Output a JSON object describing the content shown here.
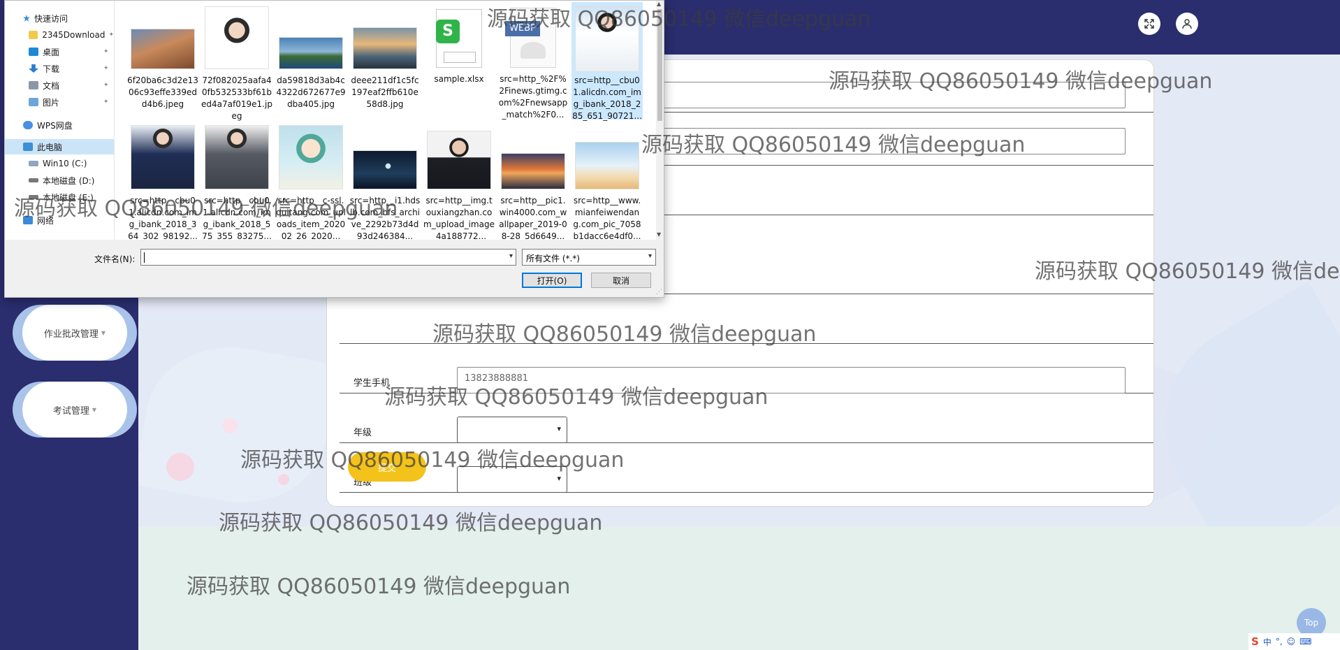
{
  "topbar": {
    "fullscreen_icon": "expand-icon",
    "user_icon": "user-icon"
  },
  "sidebar": {
    "items": [
      {
        "label": "作业批改管理"
      },
      {
        "label": "考试管理"
      }
    ]
  },
  "form": {
    "rows": [
      {
        "label": ""
      },
      {
        "label": ""
      },
      {
        "label": ""
      },
      {
        "label": ""
      },
      {
        "label": ""
      }
    ],
    "phone": {
      "label": "学生手机",
      "value": "13823888881"
    },
    "grade": {
      "label": "年级",
      "value": ""
    },
    "class": {
      "label": "班级",
      "value": ""
    },
    "submit_label": "提交"
  },
  "dialog": {
    "nav": [
      {
        "label": "快速访问",
        "icon": "star-icon"
      },
      {
        "label": "2345Download",
        "icon": "folder-icon",
        "pinned": true
      },
      {
        "label": "桌面",
        "icon": "desktop-icon",
        "pinned": true
      },
      {
        "label": "下载",
        "icon": "download-icon",
        "pinned": true
      },
      {
        "label": "文档",
        "icon": "documents-icon",
        "pinned": true
      },
      {
        "label": "图片",
        "icon": "pictures-icon",
        "pinned": true
      },
      {
        "label": "WPS网盘",
        "icon": "cloud-icon"
      },
      {
        "label": "此电脑",
        "icon": "computer-icon"
      },
      {
        "label": "Win10 (C:)",
        "icon": "drive-icon"
      },
      {
        "label": "本地磁盘 (D:)",
        "icon": "drive-icon"
      },
      {
        "label": "本地磁盘 (E:)",
        "icon": "drive-icon"
      },
      {
        "label": "网络",
        "icon": "network-icon"
      }
    ],
    "files": [
      {
        "name": "6f20ba6c3d2e1306c93effe339edd4b6.jpeg",
        "thumb": "coastal-town"
      },
      {
        "name": "72f082025aafa40fb532533bf61bed4a7af019e1.jpeg",
        "thumb": "portrait-boy"
      },
      {
        "name": "da59818d3ab4c4322d672677e9dba405.jpg",
        "thumb": "island-landscape"
      },
      {
        "name": "deee211df1c5fc197eaf2ffb610e58d8.jpg",
        "thumb": "sunset-sea"
      },
      {
        "name": "sample.xlsx",
        "thumb": "spreadsheet-icon"
      },
      {
        "name": "src=http_%2F%2Finews.gtimg.com%2Fnewsapp_match%2F0...",
        "thumb": "webp-icon"
      },
      {
        "name": "src=http__cbu01.alicdn.com_img_ibank_2018_285_651_90721...",
        "thumb": "businesswoman"
      },
      {
        "name": "src=http__cbu01.alicdn.com_img_ibank_2018_364_302_98192...",
        "thumb": "businesswoman-navy"
      },
      {
        "name": "src=http__cbu01.alicdn.com_img_ibank_2018_575_355_83275...",
        "thumb": "businesswoman-grey"
      },
      {
        "name": "src=http__c-ssl.duitang.com_uploads_item_202002_26_2020...",
        "thumb": "cartoon-boy"
      },
      {
        "name": "src=http__i1.hdslb.com_bfs_archive_2292b73d4d93d246384...",
        "thumb": "dancer-dark"
      },
      {
        "name": "src=http__img.touxiangzhan.com_upload_image_4a188772...",
        "thumb": "man-suit"
      },
      {
        "name": "src=http__pic1.win4000.com_wallpaper_2019-08-28_5d6649...",
        "thumb": "sunset-clouds"
      },
      {
        "name": "src=http__www.mianfeiwendang.com_pic_7058b1dacc6e4df0...",
        "thumb": "field-sky"
      }
    ],
    "filename_label": "文件名(N):",
    "filename_value": "",
    "filetype_value": "所有文件 (*.*)",
    "open_label": "打开(O)",
    "cancel_label": "取消",
    "webp_badge": "WEBP"
  },
  "watermark": "源码获取 QQ86050149 微信deepguan",
  "top_button": "Top",
  "ime": {
    "label": "中",
    "logo": "S"
  },
  "colors": {
    "navy": "#2a2d6e",
    "accent_yellow": "#f3c21b",
    "selection": "#cce8ff"
  }
}
